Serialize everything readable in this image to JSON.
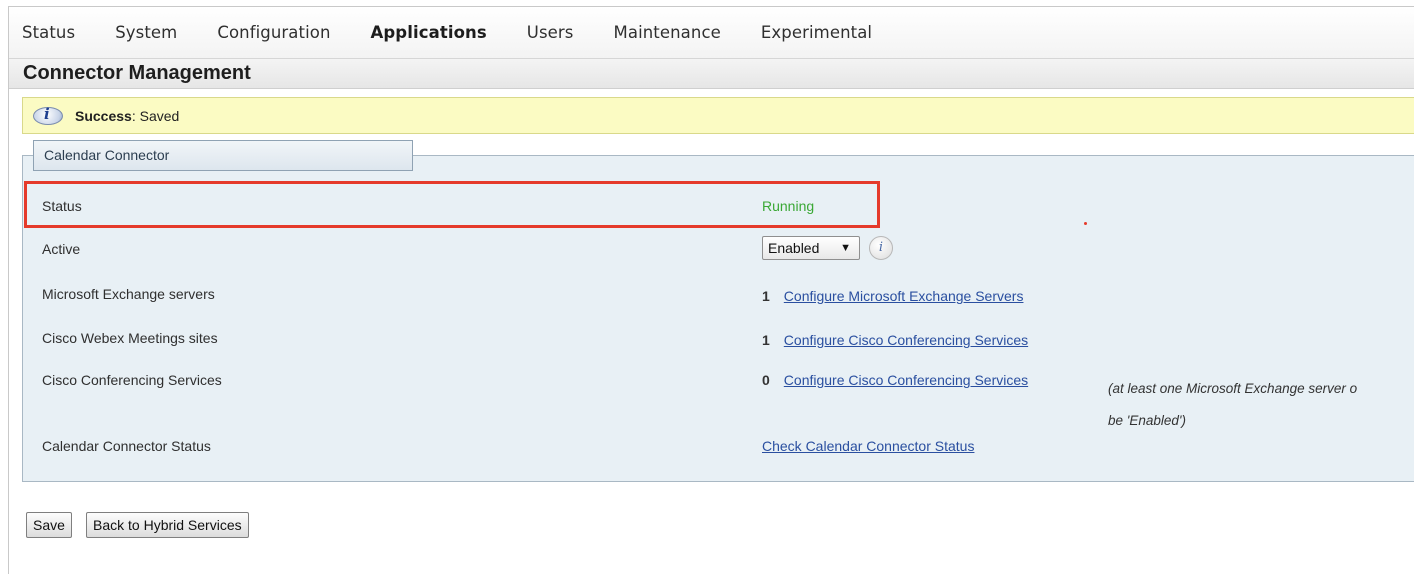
{
  "nav": {
    "items": [
      "Status",
      "System",
      "Configuration",
      "Applications",
      "Users",
      "Maintenance",
      "Experimental"
    ],
    "active": "Applications"
  },
  "page": {
    "title": "Connector Management"
  },
  "banner": {
    "label": "Success",
    "message": ": Saved",
    "icon": "info-icon"
  },
  "panel": {
    "title": "Calendar Connector",
    "rows": {
      "status": {
        "label": "Status",
        "value": "Running"
      },
      "active": {
        "label": "Active",
        "value": "Enabled"
      },
      "exchange": {
        "label": "Microsoft Exchange servers",
        "count": "1",
        "link": "Configure Microsoft Exchange Servers"
      },
      "webex": {
        "label": "Cisco Webex Meetings sites",
        "count": "1",
        "link": "Configure Cisco Conferencing Services"
      },
      "conferencing": {
        "label": "Cisco Conferencing Services",
        "count": "0",
        "link": "Configure Cisco Conferencing Services",
        "note_line1": "(at least one Microsoft Exchange server o",
        "note_line2": "be 'Enabled')"
      },
      "connector_status": {
        "label": "Calendar Connector Status",
        "link": "Check Calendar Connector Status"
      }
    }
  },
  "buttons": {
    "save": "Save",
    "back": "Back to Hybrid Services"
  },
  "colors": {
    "running": "#3aa835",
    "highlight": "#e53a2b",
    "banner": "#fbfbc3",
    "link": "#2a4fa0"
  }
}
